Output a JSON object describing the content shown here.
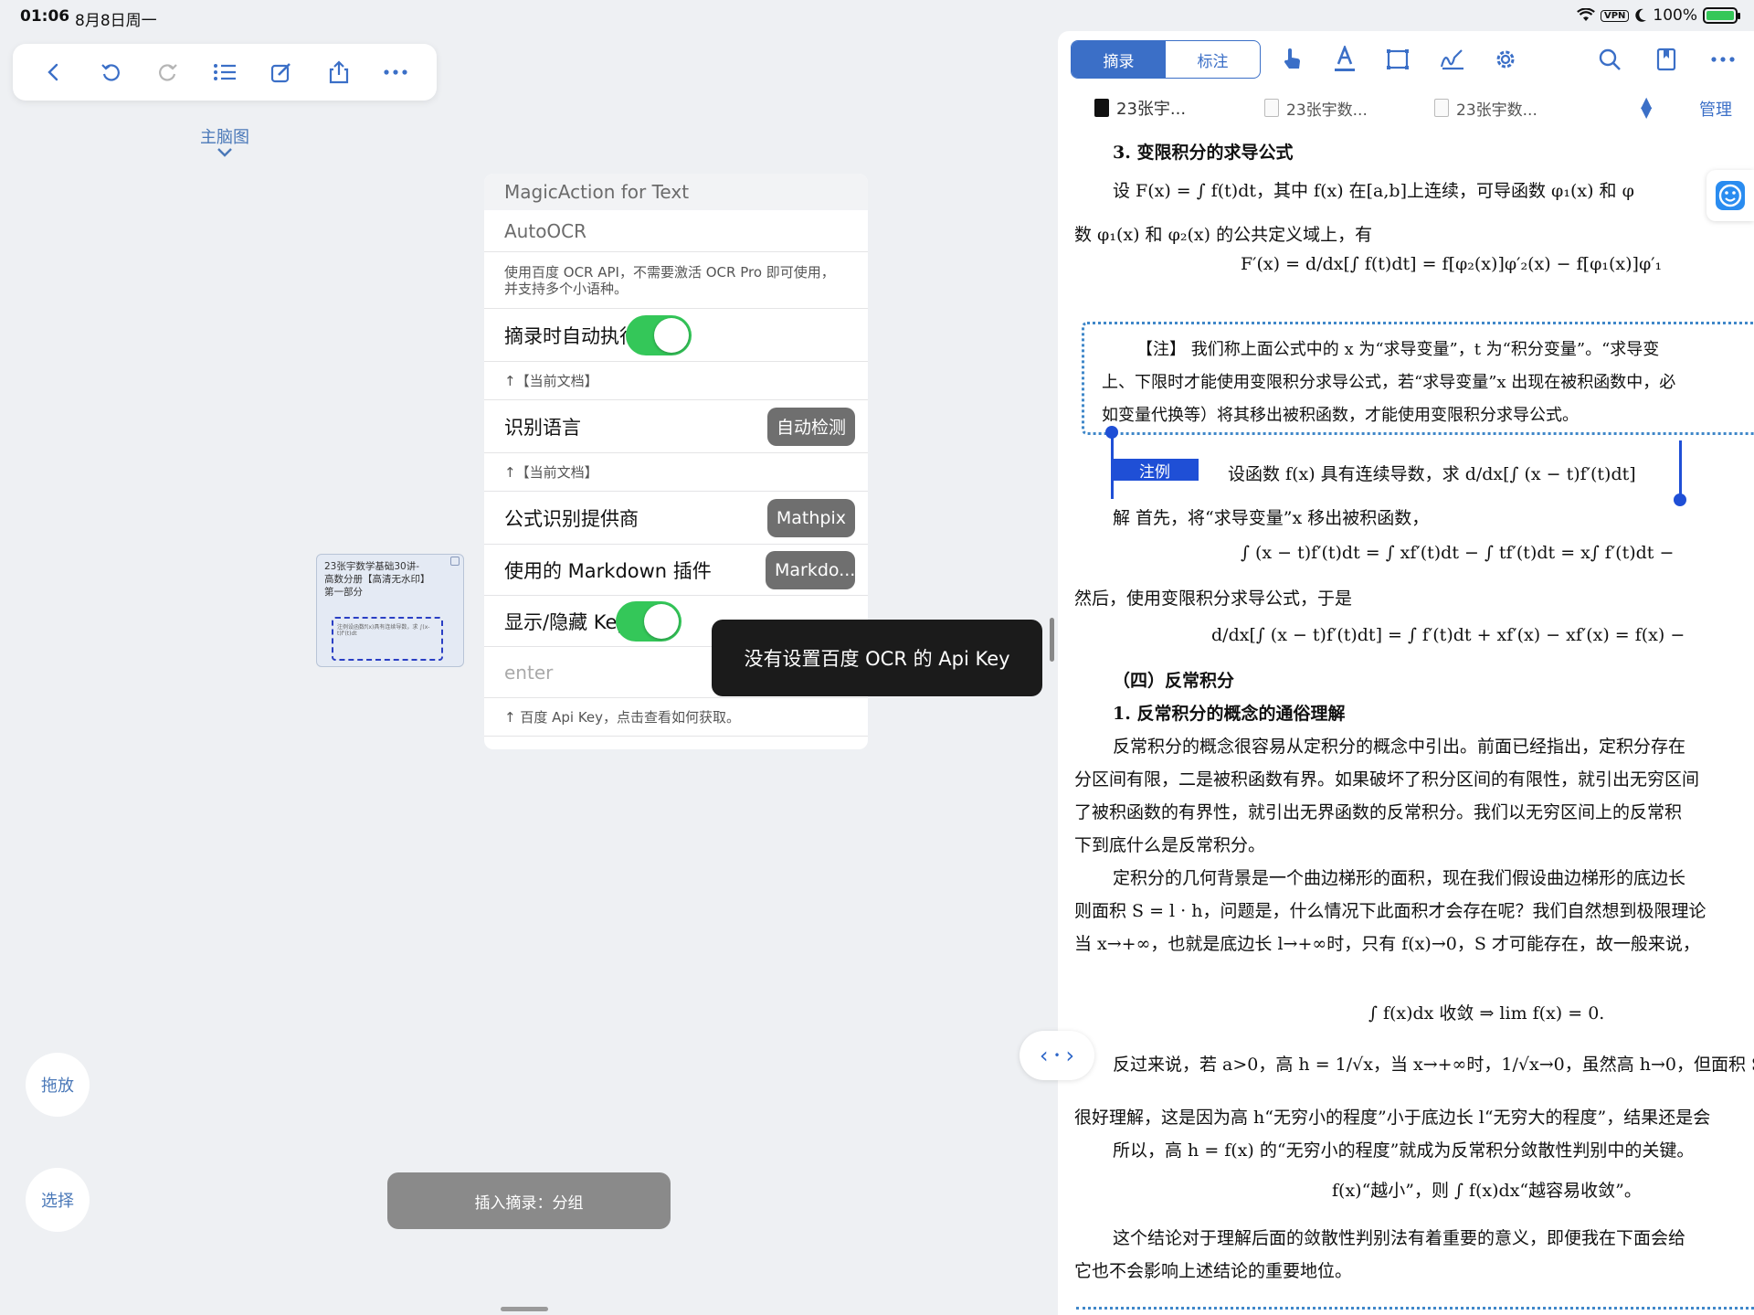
{
  "status": {
    "time": "01:06",
    "date": "8月8日周一",
    "vpn": "VPN",
    "battery": "100%",
    "battery_level": 1.0
  },
  "left_toolbar": {
    "icons": [
      "back-icon",
      "undo-icon",
      "redo-icon",
      "list-icon",
      "edit-icon",
      "share-icon",
      "more-icon"
    ]
  },
  "mindmap": {
    "label": "主脑图"
  },
  "thumbnail": {
    "title": "23张宇数学基础30讲-高数分册【高清无水印】第一部分",
    "snippet": "注例设函数f(x)具有连续导数，求 ∫(x-t)f'(t)dt"
  },
  "settings_panel": {
    "header": "MagicAction for Text",
    "section_title": "AutoOCR",
    "description": "使用百度 OCR API，不需要激活 OCR Pro 即可使用，并支持多个小语种。",
    "rows": {
      "auto_run": {
        "label": "摘录时自动执行",
        "on": true
      },
      "auto_run_note": "↑【当前文档】",
      "language": {
        "label": "识别语言",
        "value": "自动检测"
      },
      "language_note": "↑【当前文档】",
      "formula_provider": {
        "label": "公式识别提供商",
        "value": "Mathpix"
      },
      "markdown_plugin": {
        "label": "使用的 Markdown 插件",
        "value": "Markdo..."
      },
      "toggle_key": {
        "label": "显示/隐藏 Key",
        "on": true
      },
      "api_key_input": {
        "placeholder": "enter",
        "value": ""
      },
      "api_key_note": "↑ 百度 Api Key，点击查看如何获取。"
    }
  },
  "toast": {
    "message": "没有设置百度 OCR 的 Api Key"
  },
  "side_buttons": {
    "drag": "拖放",
    "select": "选择"
  },
  "insert_bar": {
    "label": "插入摘录：分组"
  },
  "right_toolbar": {
    "segments": [
      "摘录",
      "标注"
    ],
    "active_segment": 0,
    "icons": [
      "hand-icon",
      "text-highlight-icon",
      "rectangle-select-icon",
      "signature-icon",
      "settings-gear-icon",
      "search-icon",
      "bookmark-icon",
      "more-icon"
    ]
  },
  "doc_tabs": {
    "tabs": [
      "23张宇...",
      "23张宇数...",
      "23张宇数..."
    ],
    "manage": "管理"
  },
  "document": {
    "lines": [
      "3. 变限积分的求导公式",
      "设 F(x) = ∫ f(t)dt，其中 f(x) 在[a,b]上连续，可导函数 φ₁(x) 和 φ",
      "数 φ₁(x) 和 φ₂(x) 的公共定义域上，有",
      "F′(x) = d/dx[∫ f(t)dt] = f[φ₂(x)]φ′₂(x) − f[φ₁(x)]φ′₁",
      "【注】 我们称上面公式中的 x 为“求导变量”，t 为“积分变量”。“求导变",
      "上、下限时才能使用变限积分求导公式，若“求导变量”x 出现在被积函数中，必",
      "如变量代换等）将其移出被积函数，才能使用变限积分求导公式。",
      "注例",
      "设函数 f(x) 具有连续导数，求 d/dx[∫ (x − t)f′(t)dt]",
      "解   首先，将“求导变量”x 移出被积函数，",
      "∫ (x − t)f′(t)dt = ∫ xf′(t)dt − ∫ tf′(t)dt = x∫ f′(t)dt −",
      "然后，使用变限积分求导公式，于是",
      "d/dx[∫ (x − t)f′(t)dt] = ∫ f′(t)dt + xf′(x) − xf′(x) = f(x) −",
      "（四）反常积分",
      "1. 反常积分的概念的通俗理解",
      "反常积分的概念很容易从定积分的概念中引出。前面已经指出，定积分存在",
      "分区间有限，二是被积函数有界。如果破坏了积分区间的有限性，就引出无穷区间",
      "了被积函数的有界性，就引出无界函数的反常积分。我们以无穷区间上的反常积",
      "下到底什么是反常积分。",
      "定积分的几何背景是一个曲边梯形的面积，现在我们假设曲边梯形的底边长",
      "则面积 S = l · h，问题是，什么情况下此面积才会存在呢？我们自然想到极限理论",
      "当 x→+∞，也就是底边长 l→+∞时，只有 f(x)→0，S 才可能存在，故一般来说，",
      "∫ f(x)dx 收敛 ⇒ lim f(x) = 0.",
      "反过来说，若 a>0，高 h = 1/√x，当 x→+∞时，1/√x→0，虽然高 h→0，但面积 S=",
      "很好理解，这是因为高 h“无穷小的程度”小于底边长 l“无穷大的程度”，结果还是会",
      "所以，高 h = f(x) 的“无穷小的程度”就成为反常积分敛散性判别中的关键。",
      "f(x)“越小”，则 ∫ f(x)dx“越容易收敛”。",
      "这个结论对于理解后面的敛散性判别法有着重要的意义，即便我在下面会给",
      "它也不会影响上述结论的重要地位。"
    ]
  },
  "colors": {
    "accent": "#3b6fc7",
    "toggle_on": "#34c759",
    "selection": "#1f4fd6"
  }
}
